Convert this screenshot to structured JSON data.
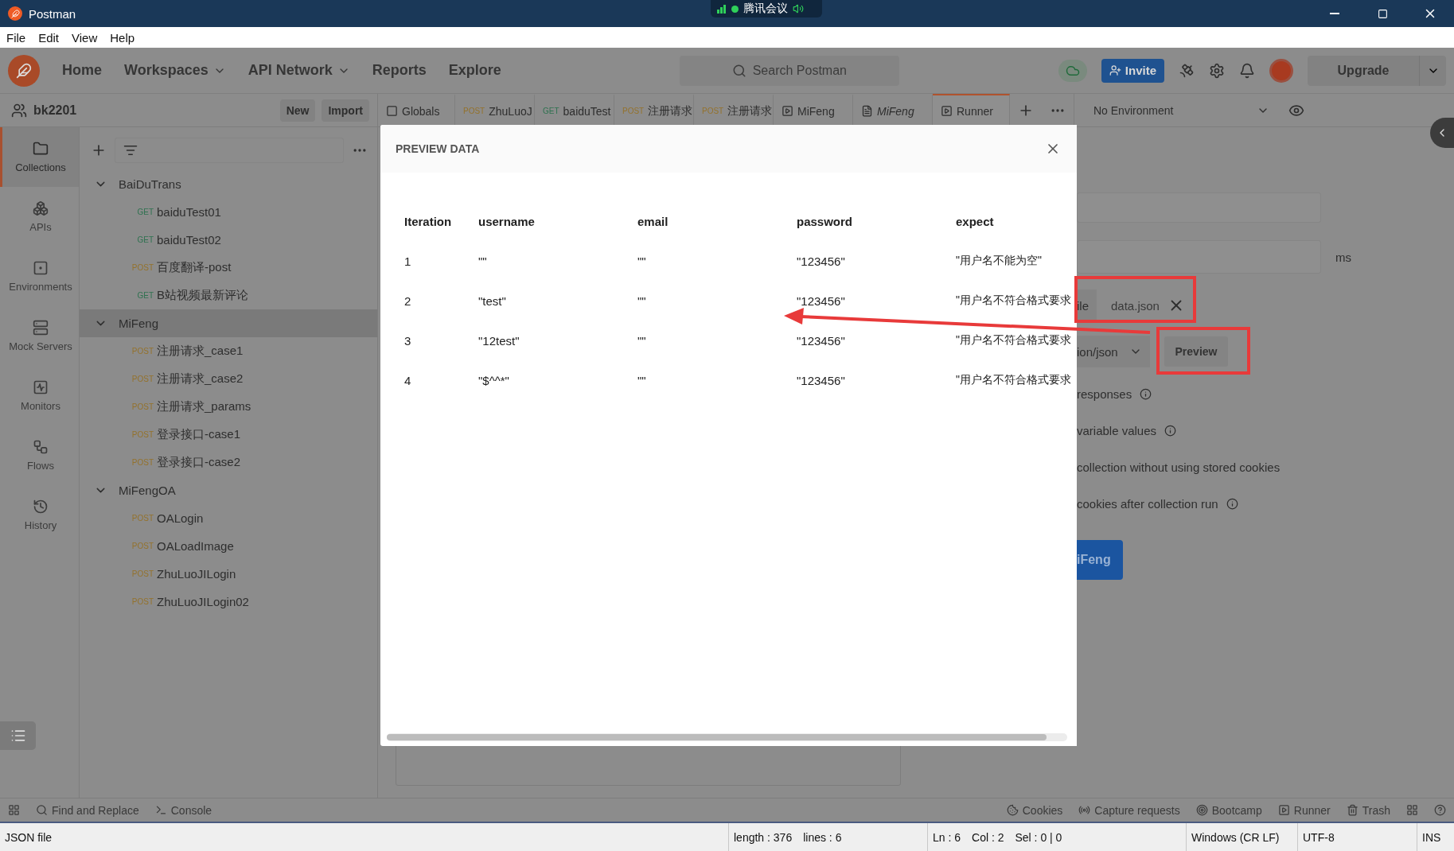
{
  "window": {
    "title": "Postman",
    "meeting_badge": "腾讯会议"
  },
  "menu": [
    "File",
    "Edit",
    "View",
    "Help"
  ],
  "nav": {
    "links": [
      {
        "label": "Home",
        "dropdown": false
      },
      {
        "label": "Workspaces",
        "dropdown": true
      },
      {
        "label": "API Network",
        "dropdown": true
      },
      {
        "label": "Reports",
        "dropdown": false
      },
      {
        "label": "Explore",
        "dropdown": false
      }
    ],
    "search_placeholder": "Search Postman",
    "invite": "Invite",
    "upgrade": "Upgrade"
  },
  "workspace": {
    "name": "bk2201",
    "buttons": [
      "New",
      "Import"
    ]
  },
  "sidebar": {
    "items": [
      {
        "kind": "collections",
        "label": "Collections",
        "selected": true
      },
      {
        "kind": "apis",
        "label": "APIs",
        "selected": false
      },
      {
        "kind": "environments",
        "label": "Environments",
        "selected": false
      },
      {
        "kind": "mock",
        "label": "Mock Servers",
        "selected": false
      },
      {
        "kind": "monitors",
        "label": "Monitors",
        "selected": false
      },
      {
        "kind": "flows",
        "label": "Flows",
        "selected": false
      },
      {
        "kind": "history",
        "label": "History",
        "selected": false
      }
    ]
  },
  "collections": [
    {
      "name": "BaiDuTrans",
      "expanded": true,
      "selected": false,
      "children": [
        {
          "method": "GET",
          "name": "baiduTest01"
        },
        {
          "method": "GET",
          "name": "baiduTest02"
        },
        {
          "method": "POST",
          "name": "百度翻译-post"
        },
        {
          "method": "GET",
          "name": "B站视频最新评论"
        }
      ]
    },
    {
      "name": "MiFeng",
      "expanded": true,
      "selected": true,
      "children": [
        {
          "method": "POST",
          "name": "注册请求_case1"
        },
        {
          "method": "POST",
          "name": "注册请求_case2"
        },
        {
          "method": "POST",
          "name": "注册请求_params"
        },
        {
          "method": "POST",
          "name": "登录接口-case1"
        },
        {
          "method": "POST",
          "name": "登录接口-case2"
        }
      ]
    },
    {
      "name": "MiFengOA",
      "expanded": true,
      "selected": false,
      "children": [
        {
          "method": "POST",
          "name": "OALogin"
        },
        {
          "method": "POST",
          "name": "OALoadImage"
        },
        {
          "method": "POST",
          "name": "ZhuLuoJILogin"
        },
        {
          "method": "POST",
          "name": "ZhuLuoJILogin02"
        }
      ]
    }
  ],
  "tabs": [
    {
      "kind": "globals",
      "label": "Globals",
      "selected": false
    },
    {
      "kind": "request",
      "method": "POST",
      "label": "ZhuLuoJ",
      "selected": false
    },
    {
      "kind": "request",
      "method": "GET",
      "label": "baiduTest",
      "selected": false
    },
    {
      "kind": "request",
      "method": "POST",
      "label": "注册请求",
      "selected": false
    },
    {
      "kind": "request",
      "method": "POST",
      "label": "注册请求",
      "selected": false
    },
    {
      "kind": "collection",
      "label": "MiFeng",
      "selected": false
    },
    {
      "kind": "preview",
      "label": "MiFeng",
      "selected": false
    },
    {
      "kind": "runner",
      "label": "Runner",
      "selected": true
    }
  ],
  "environment": "No Environment",
  "runner": {
    "delay_unit": "ms",
    "file_label": "ile",
    "file_name": "data.json",
    "file_type": "ion/json",
    "preview_button": "Preview",
    "options": [
      {
        "label": "responses",
        "info": true
      },
      {
        "label": "variable values",
        "info": true
      },
      {
        "label": "collection without using stored cookies",
        "info": false
      },
      {
        "label": "cookies after collection run",
        "info": true
      }
    ],
    "run_button": "iFeng"
  },
  "modal": {
    "title": "PREVIEW DATA",
    "columns": [
      "Iteration",
      "username",
      "email",
      "password",
      "expect"
    ],
    "rows": [
      [
        "1",
        "\"\"",
        "\"\"",
        "\"123456\"",
        "\"用户名不能为空\""
      ],
      [
        "2",
        "\"test\"",
        "\"\"",
        "\"123456\"",
        "\"用户名不符合格式要求"
      ],
      [
        "3",
        "\"12test\"",
        "\"\"",
        "\"123456\"",
        "\"用户名不符合格式要求"
      ],
      [
        "4",
        "\"$^^*\"",
        "\"\"",
        "\"123456\"",
        "\"用户名不符合格式要求"
      ]
    ]
  },
  "bottom_bar": {
    "left": [
      {
        "kind": "find",
        "label": "Find and Replace"
      },
      {
        "kind": "console",
        "label": "Console"
      }
    ],
    "right": [
      {
        "kind": "cookies",
        "label": "Cookies"
      },
      {
        "kind": "capture",
        "label": "Capture requests"
      },
      {
        "kind": "bootcamp",
        "label": "Bootcamp"
      },
      {
        "kind": "runner",
        "label": "Runner"
      },
      {
        "kind": "trash",
        "label": "Trash"
      }
    ]
  },
  "status_bar": [
    [
      "JSON file"
    ],
    [
      "length : 376",
      "lines : 6"
    ],
    [
      "Ln : 6",
      "Col : 2",
      "Sel : 0 | 0"
    ],
    [
      "Windows (CR LF)"
    ],
    [
      "UTF-8"
    ],
    [
      "INS"
    ]
  ]
}
